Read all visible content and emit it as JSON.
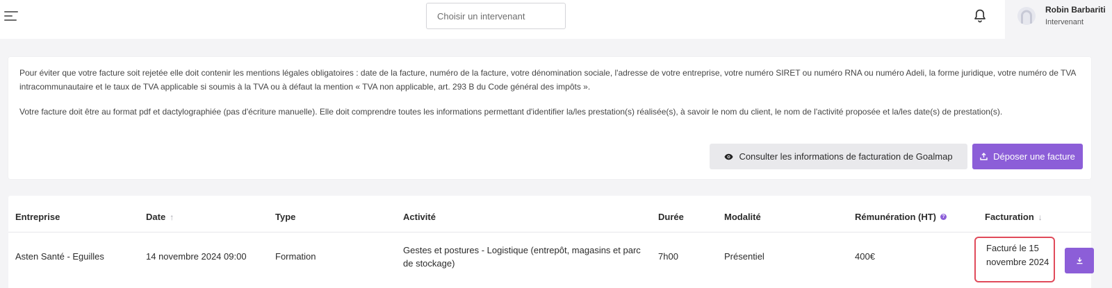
{
  "header": {
    "search_placeholder": "Choisir un intervenant",
    "user": {
      "name": "Robin Barbariti",
      "role": "Intervenant"
    }
  },
  "info": {
    "paragraph_1": "Pour éviter que votre facture soit rejetée elle doit contenir les mentions légales obligatoires : date de la facture, numéro de la facture, votre dénomination sociale, l'adresse de votre entreprise, votre numéro SIRET ou numéro RNA ou numéro Adeli, la forme juridique, votre numéro de TVA intracommunautaire et le taux de TVA applicable si soumis à la TVA ou à défaut la mention « TVA non applicable, art. 293 B du Code général des impôts ».",
    "paragraph_2": "Votre facture doit être au format pdf et dactylographiée (pas d'écriture manuelle). Elle doit comprendre toutes les informations permettant d'identifier la/les prestation(s) réalisée(s), à savoir le nom du client, le nom de l'activité proposée et la/les date(s) de prestation(s).",
    "consult_button_label": "Consulter les informations de facturation de Goalmap",
    "upload_button_label": "Déposer une facture"
  },
  "table": {
    "columns": {
      "entreprise": "Entreprise",
      "date": "Date",
      "type": "Type",
      "activite": "Activité",
      "duree": "Durée",
      "modalite": "Modalité",
      "remuneration": "Rémunération (HT)",
      "facturation": "Facturation"
    },
    "rows": [
      {
        "entreprise": "Asten Santé - Eguilles",
        "date": "14 novembre 2024 09:00",
        "type": "Formation",
        "activite": "Gestes et postures - Logistique (entrepôt, magasins et parc de stockage)",
        "duree": "7h00",
        "modalite": "Présentiel",
        "remuneration": "400€",
        "facturation": "Facturé le 15 novembre 2024"
      }
    ]
  },
  "icons": {
    "menu": "menu-icon",
    "bell": "bell-icon",
    "avatar": "avatar-icon",
    "eye": "eye-icon",
    "upload": "upload-icon",
    "download": "download-icon",
    "sort_up": "sort-up-arrow-icon",
    "sort_down": "sort-down-arrow-icon",
    "help": "question-mark-icon"
  },
  "colors": {
    "accent": "#8c5ed8",
    "highlight_border": "#e04a5a",
    "page_bg": "#f4f4f6"
  }
}
